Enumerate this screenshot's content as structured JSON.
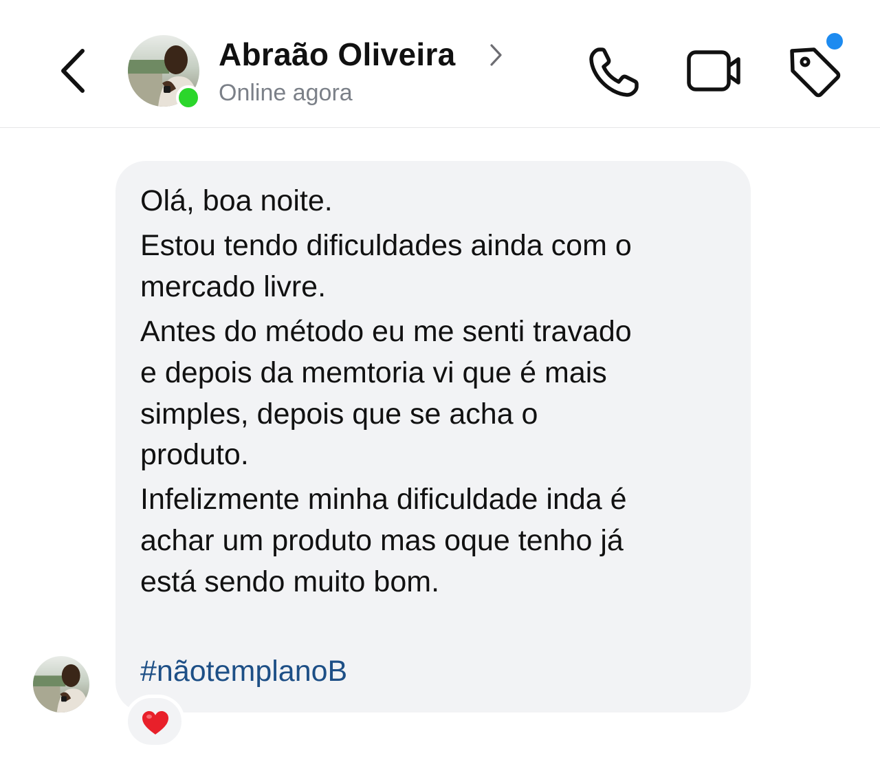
{
  "header": {
    "contact_name": "Abraão Oliveira",
    "status": "Online agora",
    "accent_online": "#2bd62b",
    "accent_notification": "#1d8bf0",
    "icons": [
      "chevron-left-icon",
      "chevron-right-icon",
      "phone-icon",
      "video-camera-icon",
      "tag-icon"
    ]
  },
  "message": {
    "lines": [
      "Olá, boa noite.",
      "Estou tendo dificuldades ainda com o",
      "mercado livre.",
      "Antes do método eu me senti travado",
      "e depois da memtoria vi que é mais",
      "simples, depois que se acha o",
      "produto.",
      "Infelizmente minha dificuldade inda é",
      "achar um produto mas oque tenho já",
      "está sendo muito bom."
    ],
    "hashtag": "#nãotemplanoB",
    "hashtag_color": "#1d4f86",
    "reaction": "heart"
  }
}
